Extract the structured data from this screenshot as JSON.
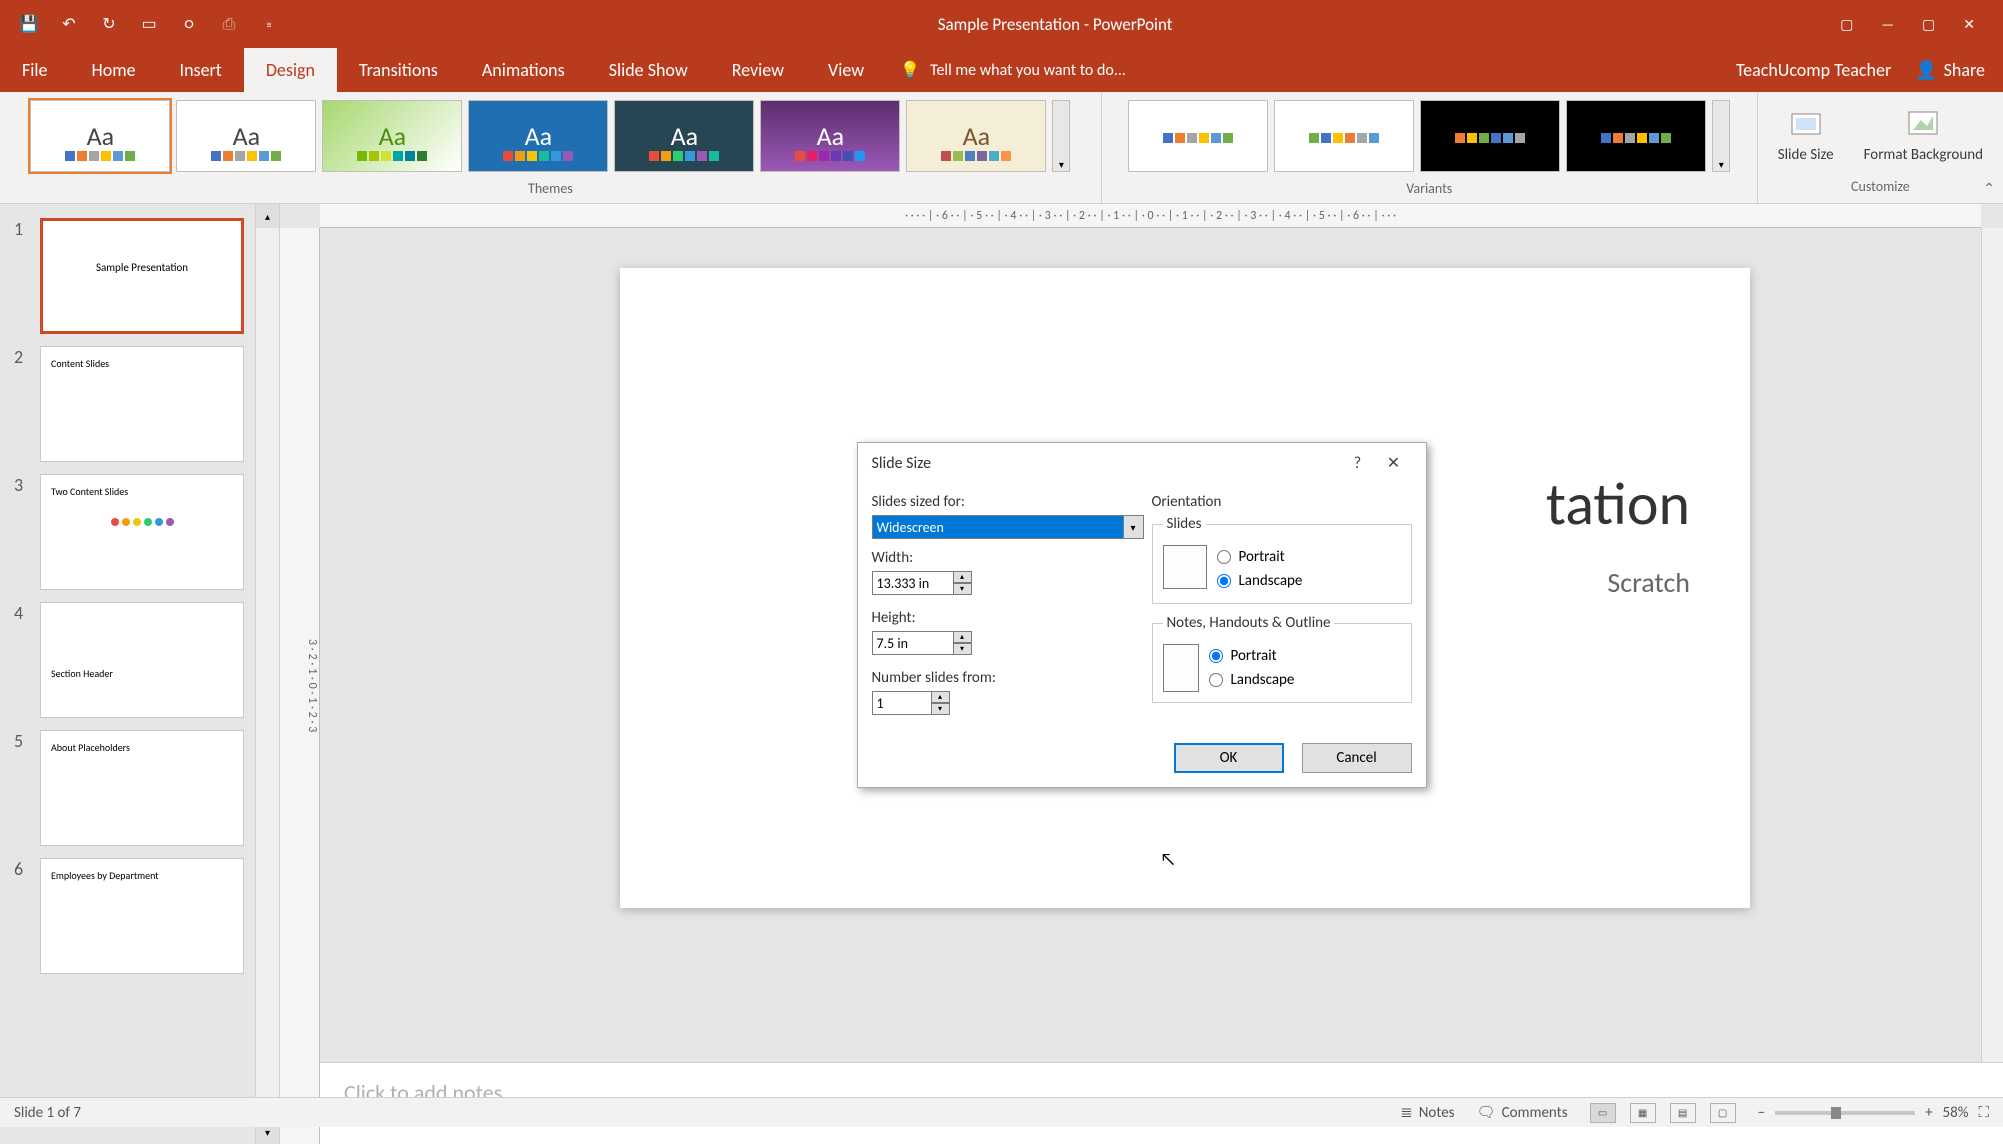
{
  "window_title": "Sample Presentation - PowerPoint",
  "ribbon_tabs": [
    "File",
    "Home",
    "Insert",
    "Design",
    "Transitions",
    "Animations",
    "Slide Show",
    "Review",
    "View"
  ],
  "active_tab_index": 3,
  "tell_me": "Tell me what you want to do...",
  "user_name": "TeachUcomp Teacher",
  "share_label": "Share",
  "themes_label": "Themes",
  "variants_label": "Variants",
  "customize_label": "Customize",
  "slide_size_label": "Slide Size",
  "format_bg_label": "Format Background",
  "thumbnails": [
    {
      "title": "Sample Presentation"
    },
    {
      "title": "Content Slides"
    },
    {
      "title": "Two Content Slides"
    },
    {
      "title": "Section Header"
    },
    {
      "title": "About Placeholders"
    },
    {
      "title": "Employees by Department"
    }
  ],
  "slide_title_partial": "tation",
  "slide_sub_partial": "Scratch",
  "notes_placeholder": "Click to add notes",
  "dialog": {
    "title": "Slide Size",
    "sized_for_label": "Slides sized for:",
    "sized_for_value": "Widescreen",
    "width_label": "Width:",
    "width_value": "13.333 in",
    "height_label": "Height:",
    "height_value": "7.5 in",
    "number_label": "Number slides from:",
    "number_value": "1",
    "orientation_label": "Orientation",
    "slides_group": "Slides",
    "notes_group": "Notes, Handouts & Outline",
    "portrait": "Portrait",
    "landscape": "Landscape",
    "ok": "OK",
    "cancel": "Cancel"
  },
  "status": {
    "slide_of": "Slide 1 of 7",
    "notes": "Notes",
    "comments": "Comments",
    "zoom": "58%"
  },
  "ruler_marks": "· · · · | · 6 · · | · 5 · · | · 4 · · | · 3 · · | · 2 · · | · 1 · · | · 0 · · | · 1 · · | · 2 · · | · 3 · · | · 4 · · | · 5 · · | · 6 · · | · · ·",
  "vruler_marks": "3 · 2 · 1 · 0 · 1 · 2 · 3"
}
